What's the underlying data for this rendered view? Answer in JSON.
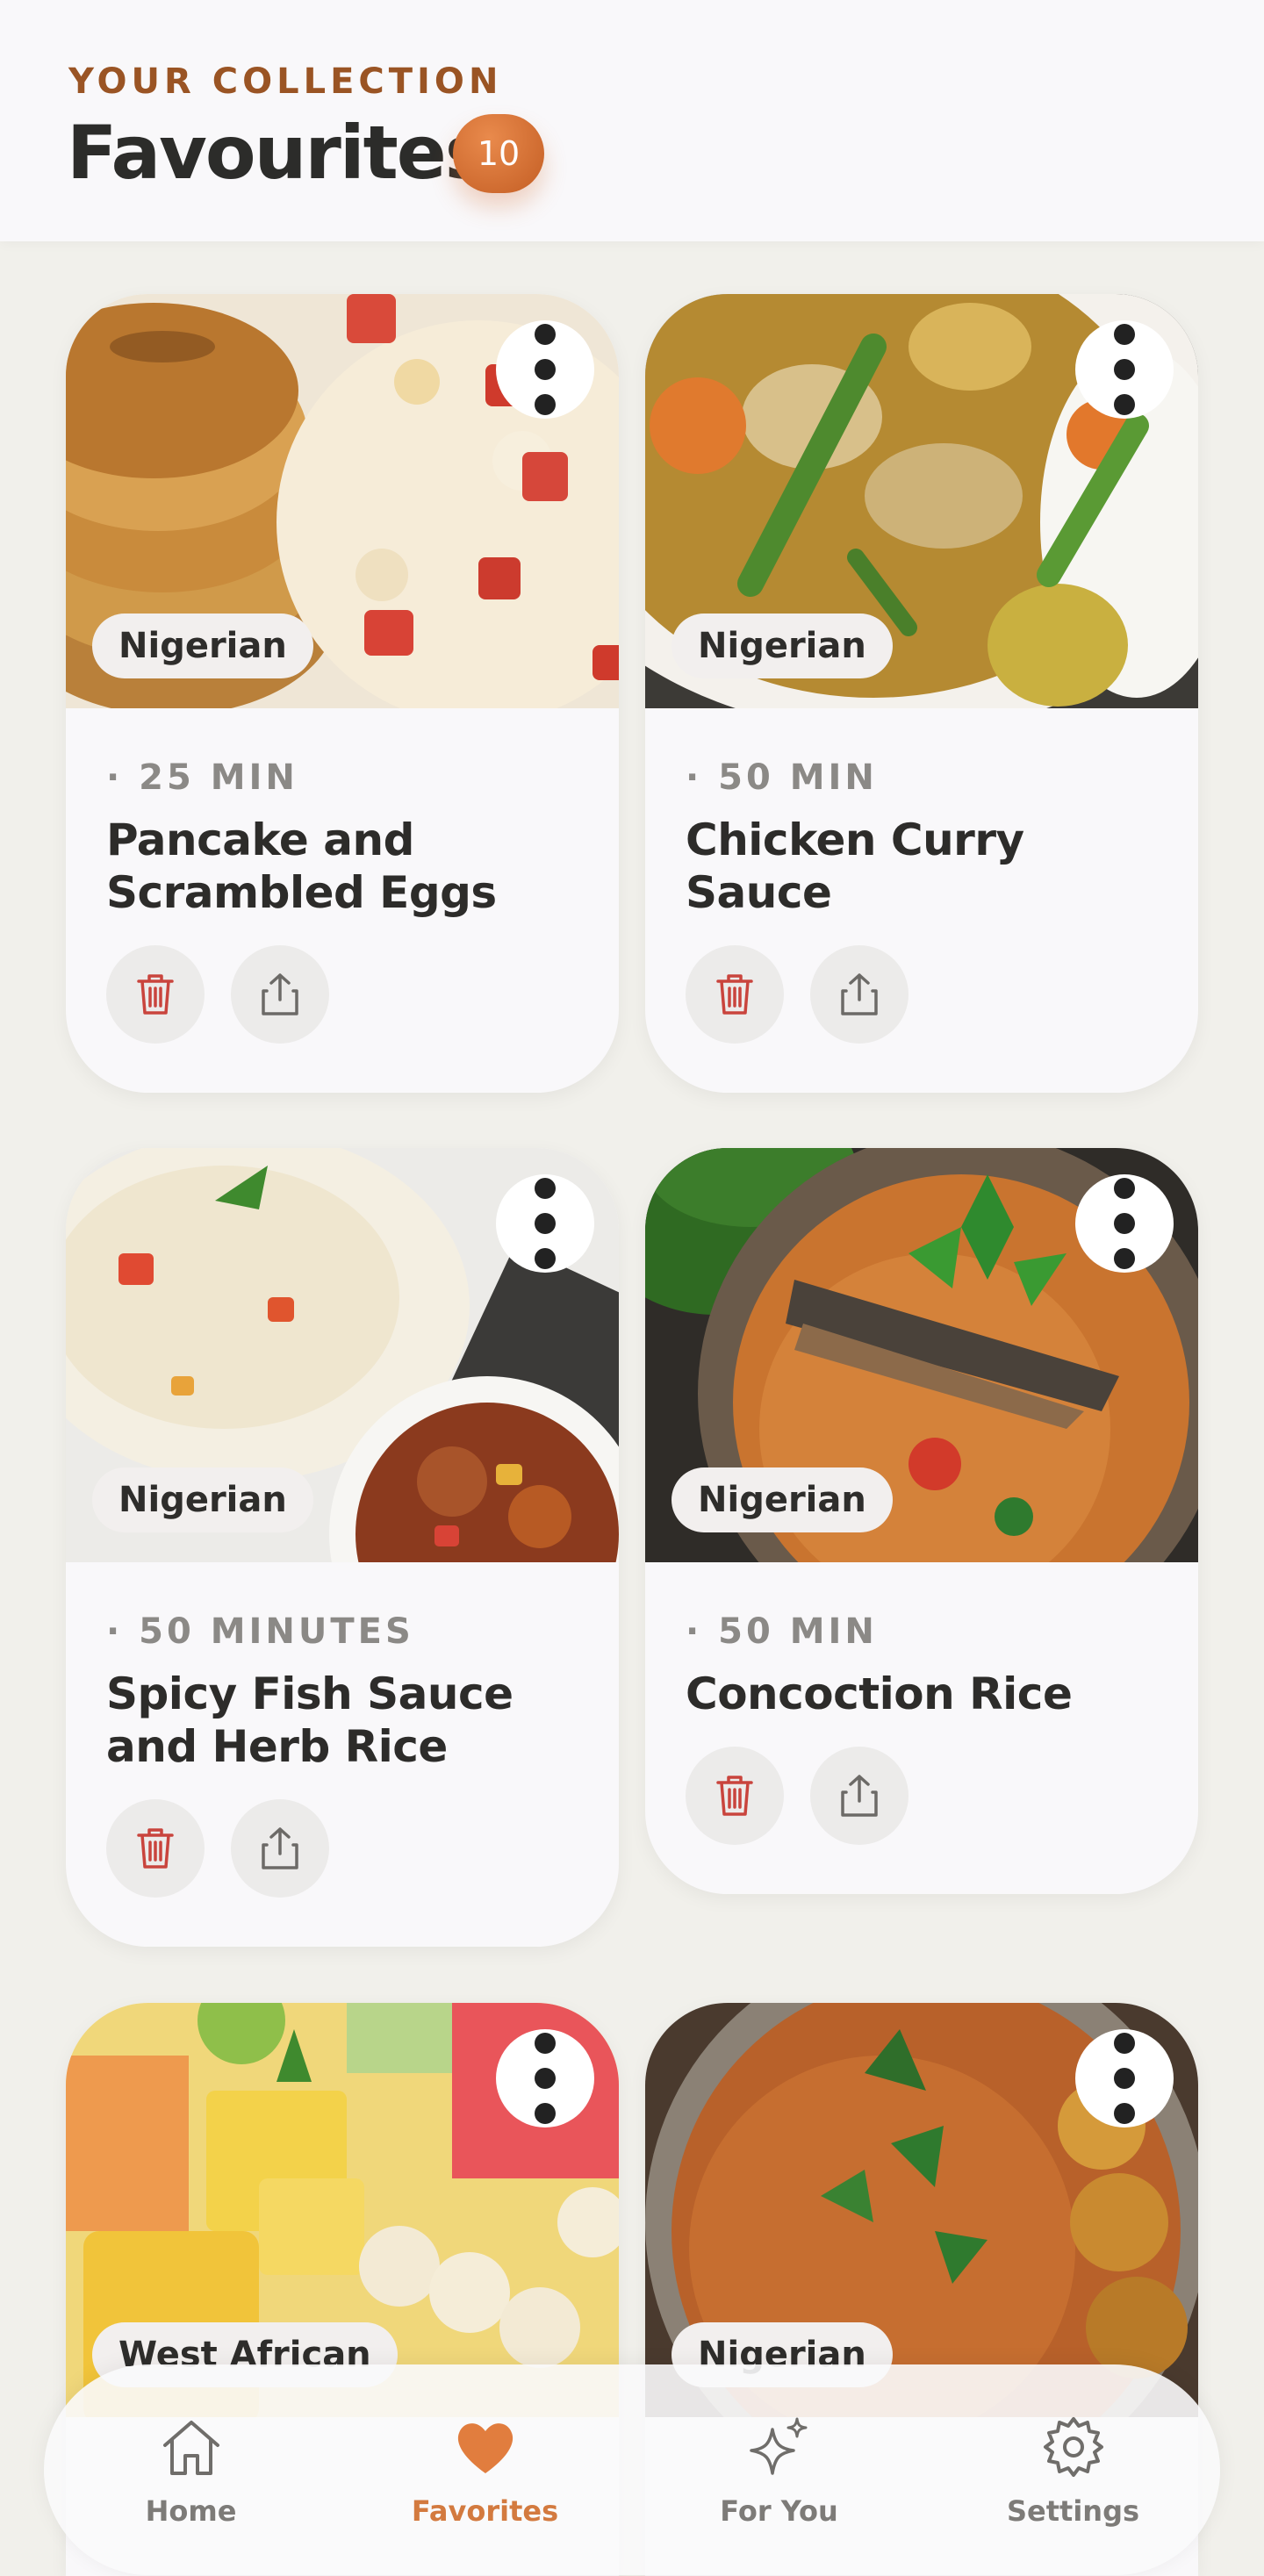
{
  "header": {
    "kicker": "YOUR COLLECTION",
    "title": "Favourites",
    "count": "10"
  },
  "recipes": [
    {
      "cuisine": "Nigerian",
      "time": "· 25 MIN",
      "name": "Pancake and Scrambled Eggs"
    },
    {
      "cuisine": "Nigerian",
      "time": "· 50 MIN",
      "name": "Chicken Curry Sauce"
    },
    {
      "cuisine": "Nigerian",
      "time": "· 50 MINUTES",
      "name": "Spicy Fish Sauce and Herb Rice"
    },
    {
      "cuisine": "Nigerian",
      "time": "· 50 MIN",
      "name": "Concoction Rice"
    },
    {
      "cuisine": "West African",
      "time": "",
      "name": ""
    },
    {
      "cuisine": "Nigerian",
      "time": "",
      "name": ""
    }
  ],
  "nav": {
    "items": [
      {
        "label": "Home",
        "icon": "home-icon"
      },
      {
        "label": "Favorites",
        "icon": "heart-icon"
      },
      {
        "label": "For You",
        "icon": "sparkles-icon"
      },
      {
        "label": "Settings",
        "icon": "gear-icon"
      }
    ],
    "active": "Favorites"
  },
  "colors": {
    "accent": "#d37a3f",
    "kicker": "#9a5424",
    "delete": "#c9443d",
    "background": "#f1f0eb"
  }
}
